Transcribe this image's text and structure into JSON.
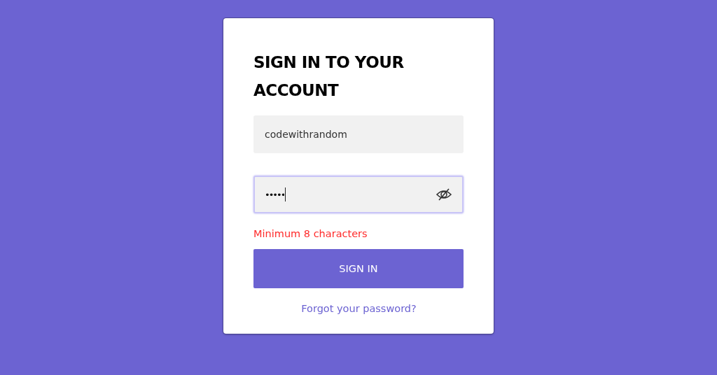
{
  "card": {
    "title": "SIGN IN TO YOUR ACCOUNT",
    "fields": [
      {
        "kind": "text",
        "value": "codewithrandom",
        "focused": false
      },
      {
        "kind": "password",
        "value": "•••••",
        "focused": true
      }
    ],
    "error": "Minimum 8 characters",
    "button": "SIGN IN",
    "link": "Forgot your password?"
  }
}
